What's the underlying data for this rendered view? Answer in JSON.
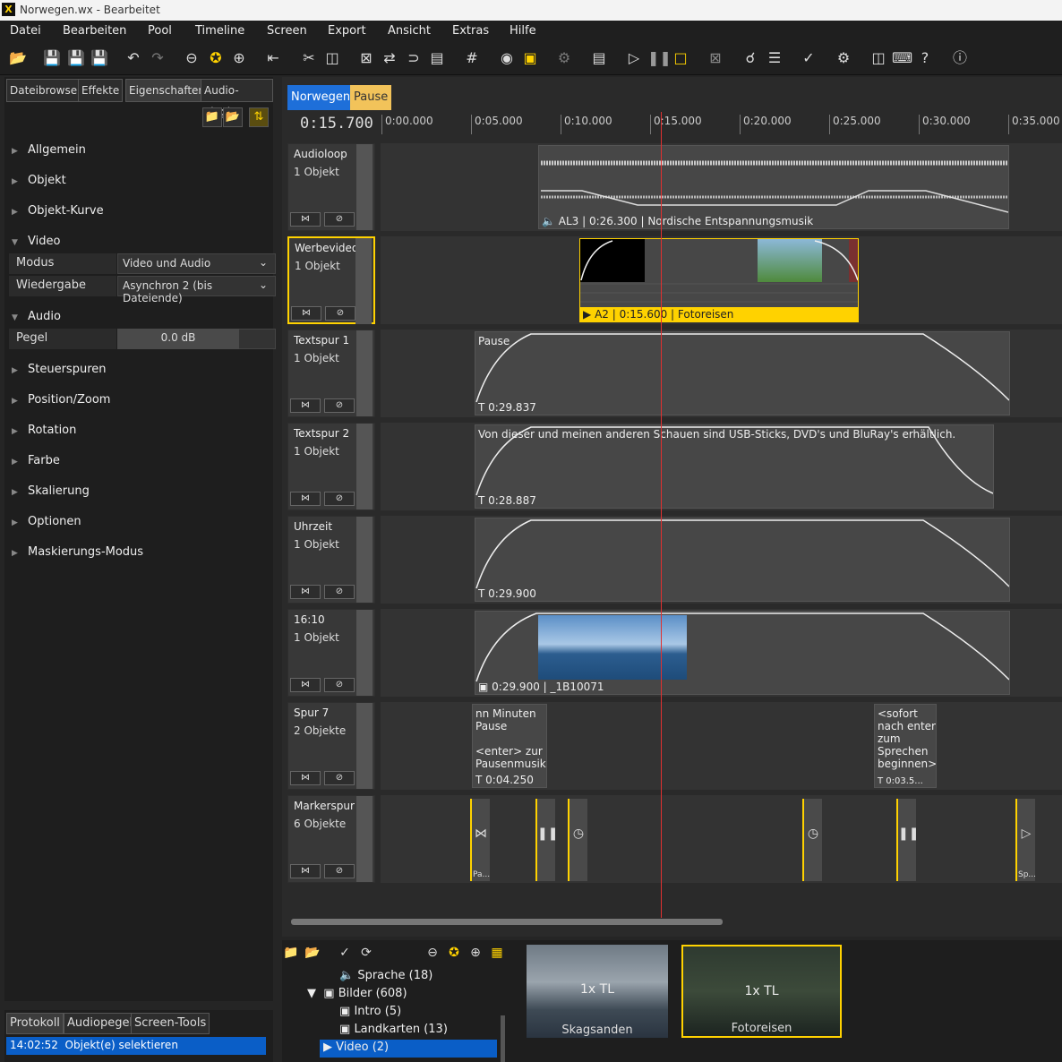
{
  "window": {
    "title": "Norwegen.wx - Bearbeitet",
    "app_glyph": "X"
  },
  "menu": [
    "Datei",
    "Bearbeiten",
    "Pool",
    "Timeline",
    "Screen",
    "Export",
    "Ansicht",
    "Extras",
    "Hilfe"
  ],
  "left_tabs": [
    "Dateibrowser",
    "Effekte",
    "Eigenschaften",
    "Audio-Plugins"
  ],
  "sections": {
    "allgemein": "Allgemein",
    "objekt": "Objekt",
    "objekt_kurve": "Objekt-Kurve",
    "video": "Video",
    "audio": "Audio",
    "steuerspuren": "Steuerspuren",
    "position_zoom": "Position/Zoom",
    "rotation": "Rotation",
    "farbe": "Farbe",
    "skalierung": "Skalierung",
    "optionen": "Optionen",
    "maskierung": "Maskierungs-Modus"
  },
  "video_props": {
    "modus_label": "Modus",
    "modus_value": "Video und Audio",
    "wiedergabe_label": "Wiedergabe",
    "wiedergabe_value": "Asynchron 2 (bis Dateiende)"
  },
  "audio_props": {
    "pegel_label": "Pegel",
    "pegel_value": "0.0 dB"
  },
  "bottom_tabs": [
    "Protokoll",
    "Audiopegel",
    "Screen-Tools"
  ],
  "log": {
    "time": "14:02:52",
    "text": "Objekt(e) selektieren"
  },
  "timeline_tabs": [
    "Norwegen",
    "Pause"
  ],
  "timecode": "0:15.700",
  "ruler": [
    "0:00.000",
    "0:05.000",
    "0:10.000",
    "0:15.000",
    "0:20.000",
    "0:25.000",
    "0:30.000",
    "0:35.000"
  ],
  "tracks": [
    {
      "name": "Audioloop",
      "count": "1 Objekt",
      "clip_label": "AL3 | 0:26.300 | Nordische Entspannungsmusik"
    },
    {
      "name": "Werbevideo",
      "count": "1 Objekt",
      "clip_label": "A2 | 0:15.600 | Fotoreisen"
    },
    {
      "name": "Textspur 1",
      "count": "1 Objekt",
      "clip_title": "Pause",
      "clip_label": "0:29.837"
    },
    {
      "name": "Textspur 2",
      "count": "1 Objekt",
      "clip_title": "Von dieser und meinen anderen Schauen sind USB-Sticks, DVD's und BluRay's erhältlich.",
      "clip_label": "0:28.887"
    },
    {
      "name": "Uhrzeit",
      "count": "1 Objekt",
      "clip_label": "0:29.900"
    },
    {
      "name": "16:10",
      "count": "1 Objekt",
      "clip_label": "0:29.900 | _1B10071"
    },
    {
      "name": "Spur 7",
      "count": "2 Objekte",
      "clip1_title": "nn Minuten\nPause\n\n<enter> zur\nPausenmusik",
      "clip1_label": "0:04.250",
      "clip2_title": "<sofort\nnach enter\nzum\nSprechen\nbeginnen>",
      "clip2_label": "0:03.5..."
    },
    {
      "name": "Markerspur",
      "count": "6 Objekte",
      "m1": "Pa...",
      "m6": "Sp..."
    }
  ],
  "pool_tree": [
    {
      "label": "Sprache (18)"
    },
    {
      "label": "Bilder (608)"
    },
    {
      "label": "Intro (5)"
    },
    {
      "label": "Landkarten (13)"
    },
    {
      "label": "Video (2)"
    }
  ],
  "thumbs": [
    {
      "badge": "1x TL",
      "caption": "Skagsanden"
    },
    {
      "badge": "1x TL",
      "caption": "Fotoreisen"
    }
  ],
  "colors": {
    "accent": "#ffd200",
    "tab_blue": "#1e6fd9",
    "tab_pause": "#f2c35a",
    "playhead": "#e03030",
    "selection": "#0a5ec7"
  }
}
